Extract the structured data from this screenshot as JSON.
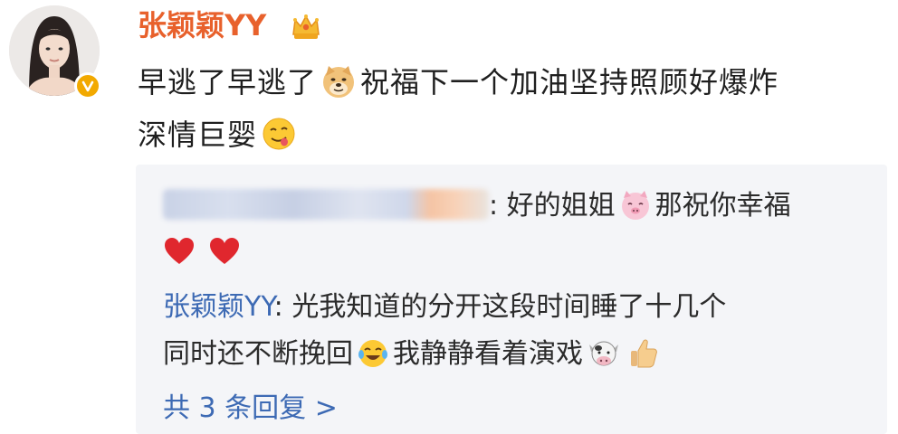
{
  "user": {
    "name": "张颖颖YY",
    "avatar_icon": "avatar-photo",
    "badge_icon": "verified-badge-icon",
    "title_icon": "crown-icon",
    "name_color": "#e8612c"
  },
  "post": {
    "line1_a": "早逃了早逃了",
    "emoji1": "doge-icon",
    "line1_b": "祝福下一个加油坚持照顾好爆炸",
    "line2": "深情巨婴",
    "emoji2": "tongue-face-icon"
  },
  "replies": [
    {
      "author": "",
      "author_blurred": true,
      "text_a": ": 好的姐姐",
      "emoji_a": "pig-face-icon",
      "text_b": "那祝你幸福",
      "line2_icons": [
        "heart-icon",
        "heart-icon"
      ]
    },
    {
      "author": "张颖颖YY",
      "text_a": ": 光我知道的分开这段时间睡了十几个",
      "line2_a": "同时还不断挽回",
      "emoji_a": "tears-of-joy-icon",
      "line2_b": "我静静看着演戏",
      "emoji_b": "cow-face-icon",
      "emoji_c": "thumbs-up-icon"
    }
  ],
  "more_replies": "共 3 条回复 >",
  "colors": {
    "link": "#3d6ab4",
    "reply_bg": "#f4f5f8"
  }
}
